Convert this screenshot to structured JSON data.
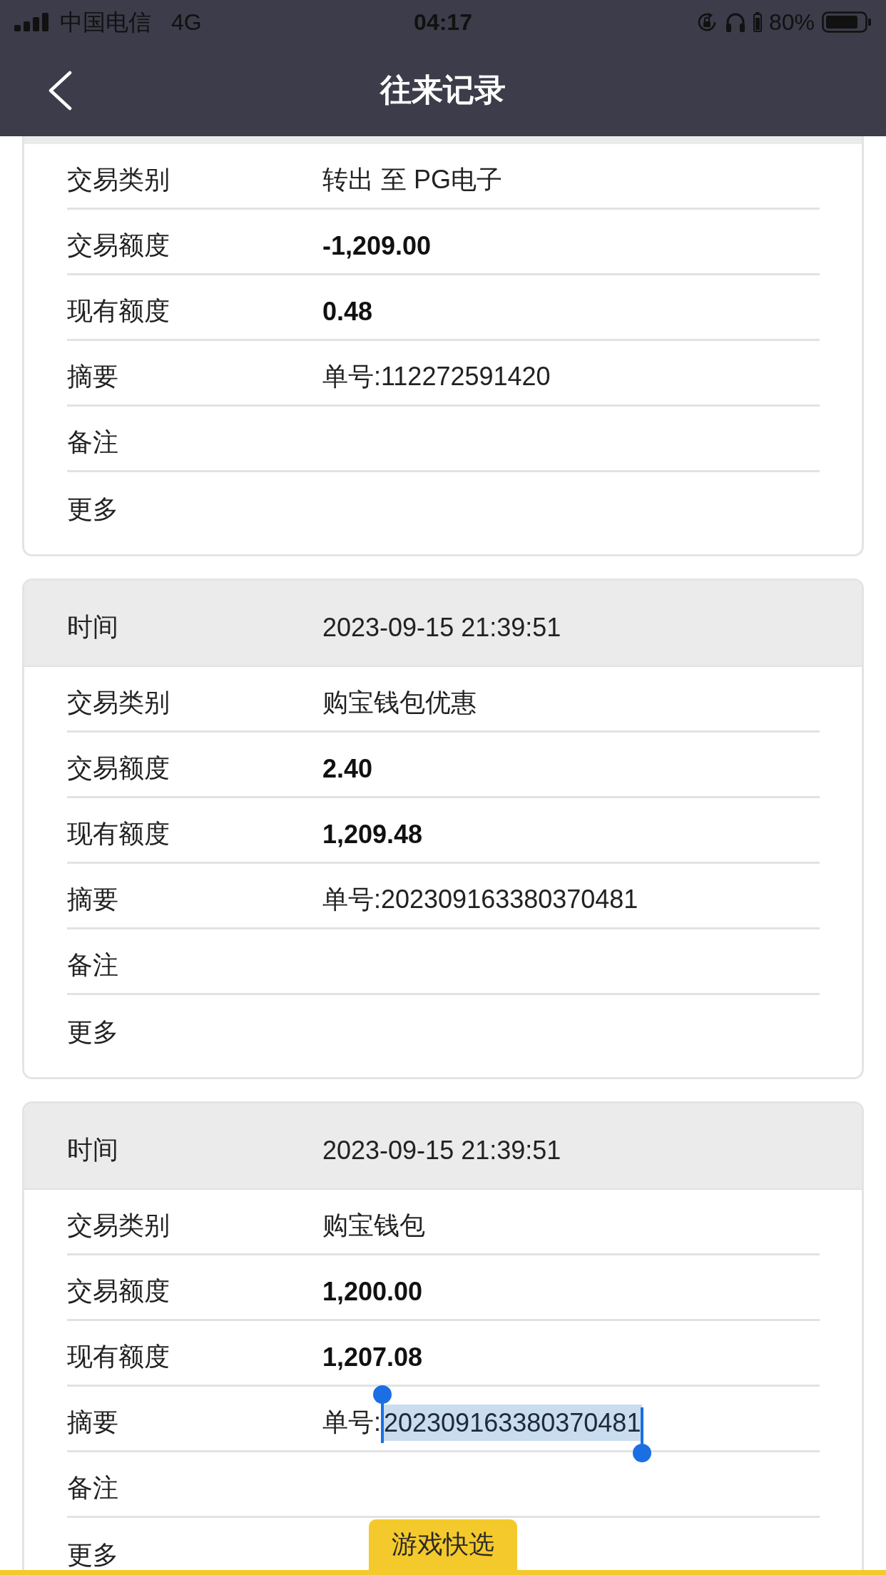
{
  "status_bar": {
    "carrier": "中国电信",
    "network": "4G",
    "time": "04:17",
    "battery": "80%"
  },
  "nav": {
    "title": "往来记录"
  },
  "records": [
    {
      "kind": "clipped_top",
      "rows": [
        {
          "label": "交易类别",
          "value": "转出 至 PG电子",
          "kind": "text"
        },
        {
          "label": "交易额度",
          "value": "-1,209.00",
          "kind": "amount"
        },
        {
          "label": "现有额度",
          "value": "0.48",
          "kind": "amount"
        },
        {
          "label": "摘要",
          "value": "单号:112272591420",
          "kind": "text"
        },
        {
          "label": "备注",
          "kind": "text"
        },
        {
          "label": "更多",
          "kind": "text"
        }
      ]
    },
    {
      "kind": "full",
      "header": {
        "label": "时间",
        "value": "2023-09-15 21:39:51"
      },
      "rows": [
        {
          "label": "交易类别",
          "value": "购宝钱包优惠",
          "kind": "text"
        },
        {
          "label": "交易额度",
          "value": "2.40",
          "kind": "amount"
        },
        {
          "label": "现有额度",
          "value": "1,209.48",
          "kind": "amount"
        },
        {
          "label": "摘要",
          "value": "单号:202309163380370481",
          "kind": "text"
        },
        {
          "label": "备注",
          "kind": "text"
        },
        {
          "label": "更多",
          "kind": "text"
        }
      ]
    },
    {
      "kind": "full",
      "header": {
        "label": "时间",
        "value": "2023-09-15 21:39:51"
      },
      "rows": [
        {
          "label": "交易类别",
          "value": "购宝钱包",
          "kind": "text"
        },
        {
          "label": "交易额度",
          "value": "1,200.00",
          "kind": "amount"
        },
        {
          "label": "现有额度",
          "value": "1,207.08",
          "kind": "amount"
        },
        {
          "label": "摘要",
          "value": "单号:",
          "selected_text": "202309163380370481",
          "kind": "text"
        },
        {
          "label": "备注",
          "kind": "text"
        },
        {
          "label": "更多",
          "kind": "text"
        }
      ]
    }
  ],
  "floating_tab": {
    "label": "游戏快选"
  }
}
